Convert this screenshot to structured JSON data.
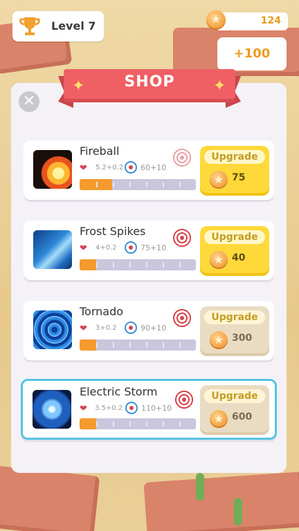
{
  "hud": {
    "level_label": "Level 7",
    "coins": "124",
    "bonus": "+100"
  },
  "shop": {
    "title": "SHOP",
    "close_symbol": "✕",
    "items": [
      {
        "name": "Fireball",
        "stat1": "5.2+0.2",
        "stat2": "60+10",
        "upgrade_label": "Upgrade",
        "price": "75",
        "level_fraction": 0.28,
        "affordable": true
      },
      {
        "name": "Frost Spikes",
        "stat1": "4+0.2",
        "stat2": "75+10",
        "upgrade_label": "Upgrade",
        "price": "40",
        "level_fraction": 0.14,
        "affordable": true
      },
      {
        "name": "Tornado",
        "stat1": "3+0.2",
        "stat2": "90+10",
        "upgrade_label": "Upgrade",
        "price": "300",
        "level_fraction": 0.14,
        "affordable": false
      },
      {
        "name": "Electric Storm",
        "stat1": "3.5+0.2",
        "stat2": "110+10",
        "upgrade_label": "Upgrade",
        "price": "600",
        "level_fraction": 0.14,
        "affordable": false,
        "selected": true
      }
    ]
  },
  "colors": {
    "accent_red": "#ef5f64",
    "upgrade_gold": "#ffd93a",
    "selected_border": "#54c3e3",
    "progress_orange": "#f59a2e"
  },
  "icons": [
    "trophy-icon",
    "coin-icon",
    "close-icon",
    "sparkle-icon",
    "damage-icon",
    "range-icon",
    "target-icon"
  ]
}
